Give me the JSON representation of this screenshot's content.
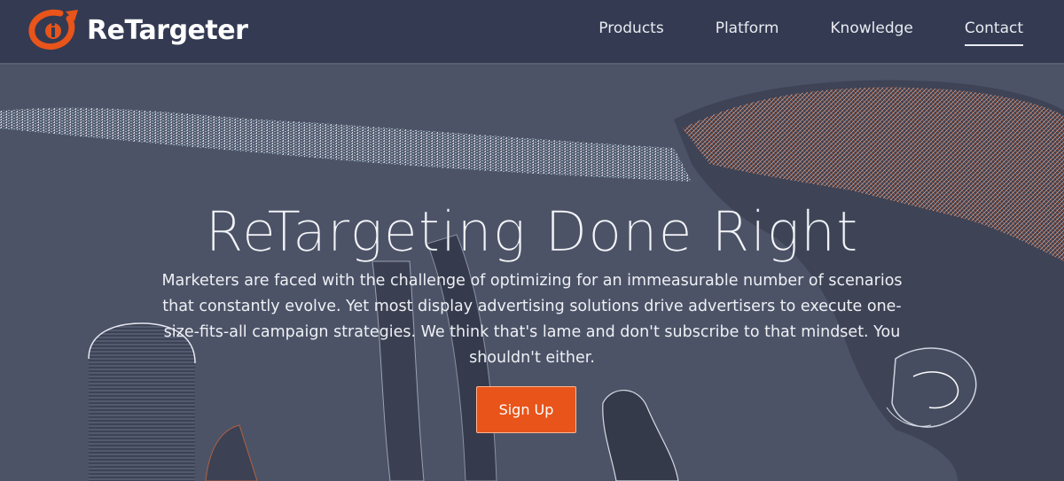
{
  "brand": {
    "name": "ReTargeter"
  },
  "nav": {
    "items": [
      {
        "label": "Products"
      },
      {
        "label": "Platform"
      },
      {
        "label": "Knowledge"
      },
      {
        "label": "Contact"
      }
    ]
  },
  "hero": {
    "title": "ReTargeting Done Right",
    "body": "Marketers are faced with the challenge of optimizing for an immeasurable number of scenarios that constantly evolve. Yet most display advertising solutions drive advertisers to execute one-size-fits-all campaign strategies. We think that's lame and don't subscribe to that mindset. You shouldn't either.",
    "cta_label": "Sign Up"
  },
  "colors": {
    "nav_bg": "#333a52",
    "hero_bg": "#4c5367",
    "accent": "#e8541a",
    "text": "#ffffff"
  }
}
